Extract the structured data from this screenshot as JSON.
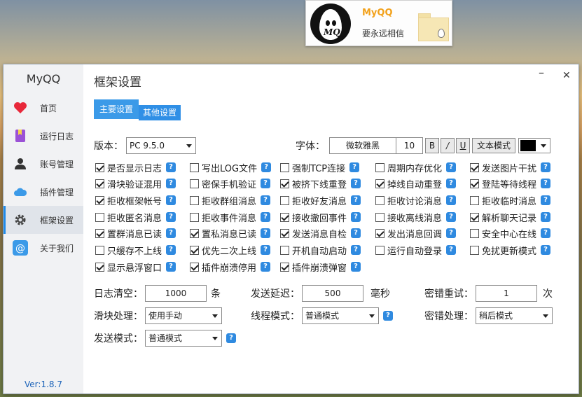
{
  "profile": {
    "name": "MyQQ",
    "signature": "要永远相信",
    "avatar_text": "MQ"
  },
  "app": {
    "title": "MyQQ",
    "version": "Ver:1.8.7"
  },
  "sidebar": {
    "items": [
      {
        "label": "首页",
        "icon": "heart-icon"
      },
      {
        "label": "运行日志",
        "icon": "bookmark-icon"
      },
      {
        "label": "账号管理",
        "icon": "user-icon"
      },
      {
        "label": "插件管理",
        "icon": "cloud-icon"
      },
      {
        "label": "框架设置",
        "icon": "gear-icon",
        "active": true
      },
      {
        "label": "关于我们",
        "icon": "at-icon"
      }
    ]
  },
  "page": {
    "title": "框架设置",
    "min": "–",
    "close": "✕"
  },
  "tabs": {
    "main": "主要设置",
    "other": "其他设置"
  },
  "version": {
    "label": "版本：",
    "value": "PC   9.5.0"
  },
  "font": {
    "label": "字体：",
    "name": "微软雅黑",
    "size": "10",
    "bold": "B",
    "italic": "/",
    "underline": "U",
    "mode": "文本模式"
  },
  "checkboxes": [
    {
      "label": "是否显示日志",
      "checked": true
    },
    {
      "label": "写出LOG文件",
      "checked": false
    },
    {
      "label": "强制TCP连接",
      "checked": false
    },
    {
      "label": "周期内存优化",
      "checked": false
    },
    {
      "label": "发送图片干扰",
      "checked": true
    },
    {
      "label": "滑块验证混用",
      "checked": true
    },
    {
      "label": "密保手机验证",
      "checked": false
    },
    {
      "label": "被挤下线重登",
      "checked": true
    },
    {
      "label": "掉线自动重登",
      "checked": true
    },
    {
      "label": "登陆等待线程",
      "checked": true
    },
    {
      "label": "拒收框架帐号",
      "checked": true
    },
    {
      "label": "拒收群组消息",
      "checked": false
    },
    {
      "label": "拒收好友消息",
      "checked": false
    },
    {
      "label": "拒收讨论消息",
      "checked": false
    },
    {
      "label": "拒收临时消息",
      "checked": false
    },
    {
      "label": "拒收匿名消息",
      "checked": false
    },
    {
      "label": "拒收事件消息",
      "checked": false
    },
    {
      "label": "接收撤回事件",
      "checked": true
    },
    {
      "label": "接收离线消息",
      "checked": false
    },
    {
      "label": "解析聊天记录",
      "checked": true
    },
    {
      "label": "置群消息已读",
      "checked": true
    },
    {
      "label": "置私消息已读",
      "checked": true
    },
    {
      "label": "发送消息自检",
      "checked": true
    },
    {
      "label": "发出消息回调",
      "checked": true
    },
    {
      "label": "安全中心在线",
      "checked": false
    },
    {
      "label": "只缓存不上线",
      "checked": false
    },
    {
      "label": "优先二次上线",
      "checked": true
    },
    {
      "label": "开机自动启动",
      "checked": false
    },
    {
      "label": "运行自动登录",
      "checked": false
    },
    {
      "label": "免扰更新模式",
      "checked": false
    },
    {
      "label": "显示悬浮窗口",
      "checked": true
    },
    {
      "label": "插件崩溃停用",
      "checked": true
    },
    {
      "label": "插件崩溃弹窗",
      "checked": true
    }
  ],
  "fields": {
    "log_clear": {
      "label": "日志清空：",
      "value": "1000",
      "unit": "条"
    },
    "send_delay": {
      "label": "发送延迟：",
      "value": "500",
      "unit": "毫秒"
    },
    "pwd_retry": {
      "label": "密错重试：",
      "value": "1",
      "unit": "次"
    },
    "slider": {
      "label": "滑块处理：",
      "value": "使用手动"
    },
    "thread": {
      "label": "线程模式：",
      "value": "普通模式"
    },
    "pwd_handle": {
      "label": "密错处理：",
      "value": "稍后模式"
    },
    "send_mode": {
      "label": "发送模式：",
      "value": "普通模式"
    }
  },
  "help_glyph": "?",
  "colors": {
    "accent": "#3b9ae8",
    "brand_name": "#f2a11a",
    "version": "#1a62b8"
  }
}
